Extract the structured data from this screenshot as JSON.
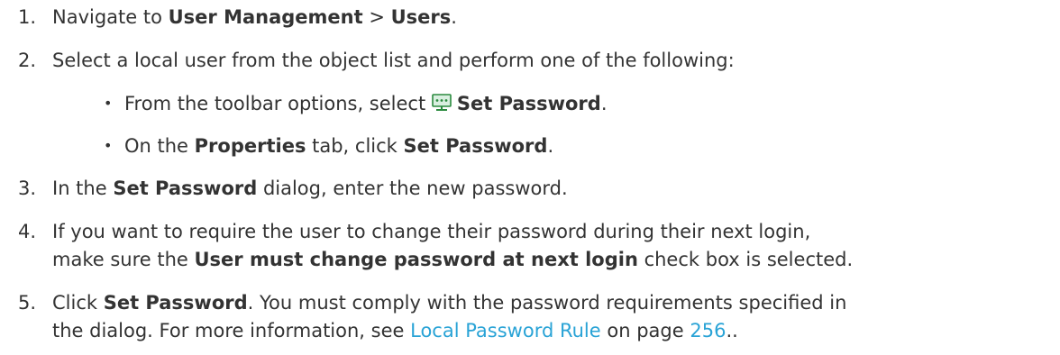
{
  "steps": {
    "s1": {
      "num": "1.",
      "pre": "Navigate to ",
      "b1": "User Management",
      "mid": " > ",
      "b2": "Users",
      "post": "."
    },
    "s2": {
      "num": "2.",
      "text": "Select a local user from the object list and perform one of the following:"
    },
    "b1": {
      "bullet": "•",
      "pre": "From the toolbar options, select ",
      "icon": "set-password-toolbar-icon",
      "bold": "Set Password",
      "post": "."
    },
    "b2": {
      "bullet": "•",
      "pre": "On the ",
      "bold1": "Properties",
      "mid": " tab, click ",
      "bold2": "Set Password",
      "post": "."
    },
    "s3": {
      "num": "3.",
      "pre": "In the ",
      "bold": "Set Password",
      "post": " dialog, enter the new password."
    },
    "s4": {
      "num": "4.",
      "line1": "If you want to require the user to change their password during their next login,",
      "pre": "make sure the ",
      "bold": "User must change password at next login",
      "post": " check box is selected."
    },
    "s5": {
      "num": "5.",
      "pre": "Click ",
      "bold": "Set Password",
      "line1_post": ". You must comply with the password requirements specified in",
      "line2_pre": "the dialog. For more information, see ",
      "link": "Local Password Rule",
      "mid": " on page ",
      "page_link": "256",
      "post": ".."
    }
  },
  "colors": {
    "text": "#333333",
    "link": "#29a3d6",
    "icon_monitor": "#2a8a3e"
  }
}
